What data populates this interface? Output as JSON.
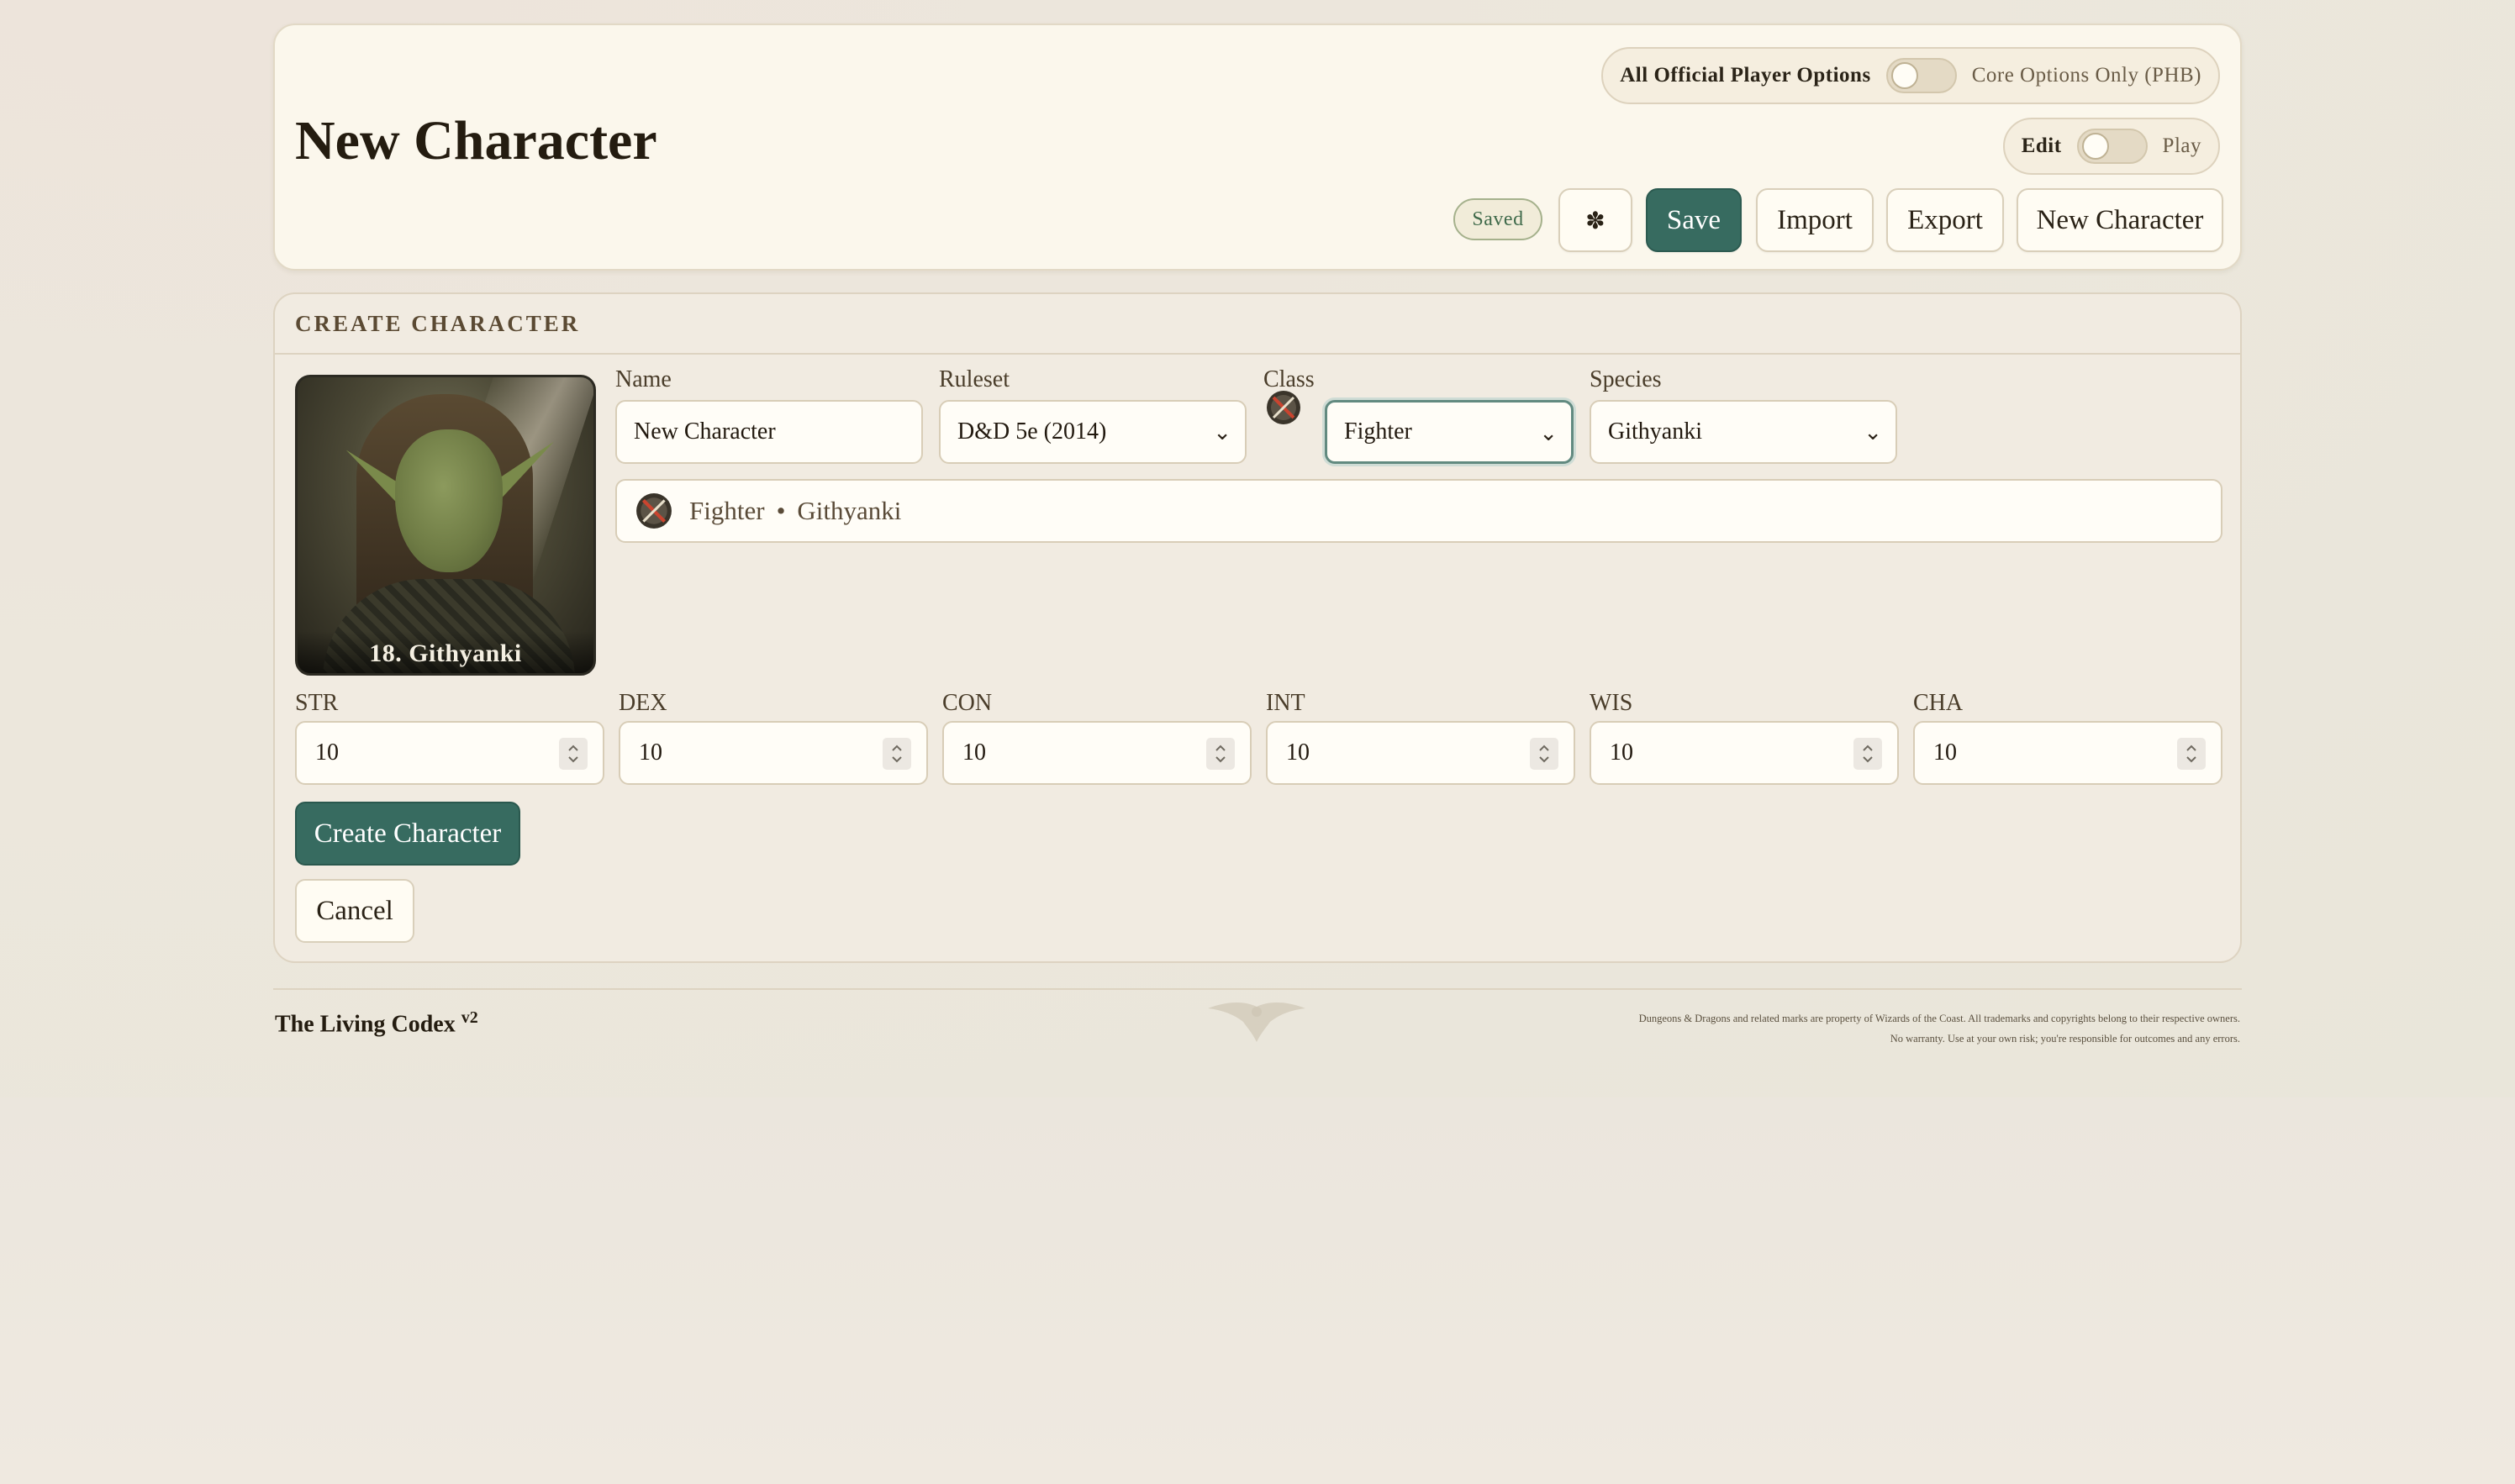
{
  "header": {
    "title": "New Character",
    "options_toggle": {
      "left_label": "All Official Player Options",
      "right_label": "Core Options Only (PHB)",
      "state": "off"
    },
    "mode_toggle": {
      "left_label": "Edit",
      "right_label": "Play",
      "state": "off"
    },
    "saved_badge": "Saved",
    "settings_icon": "gear-icon",
    "settings_glyph": "✽",
    "buttons": {
      "save": "Save",
      "import": "Import",
      "export": "Export",
      "new_character": "New Character"
    }
  },
  "create": {
    "section_title": "CREATE CHARACTER",
    "portrait_caption": "18. Githyanki",
    "fields": {
      "name_label": "Name",
      "name_value": "New Character",
      "ruleset_label": "Ruleset",
      "ruleset_value": "D&D 5e (2014)",
      "class_label": "Class",
      "class_value": "Fighter",
      "species_label": "Species",
      "species_value": "Githyanki"
    },
    "summary": {
      "class": "Fighter",
      "separator": "•",
      "species": "Githyanki"
    },
    "stats": [
      {
        "label": "STR",
        "value": "10"
      },
      {
        "label": "DEX",
        "value": "10"
      },
      {
        "label": "CON",
        "value": "10"
      },
      {
        "label": "INT",
        "value": "10"
      },
      {
        "label": "WIS",
        "value": "10"
      },
      {
        "label": "CHA",
        "value": "10"
      }
    ],
    "create_button": "Create Character",
    "cancel_button": "Cancel"
  },
  "footer": {
    "brand": "The Living Codex",
    "version": "v2",
    "legal_line1": "Dungeons & Dragons and related marks are property of Wizards of the Coast. All trademarks and copyrights belong to their respective owners.",
    "legal_line2": "No warranty. Use at your own risk; you're responsible for outcomes and any errors."
  },
  "colors": {
    "accent": "#376b60",
    "card_bg": "#fbf7ec",
    "saved_text": "#3f6a4a"
  }
}
